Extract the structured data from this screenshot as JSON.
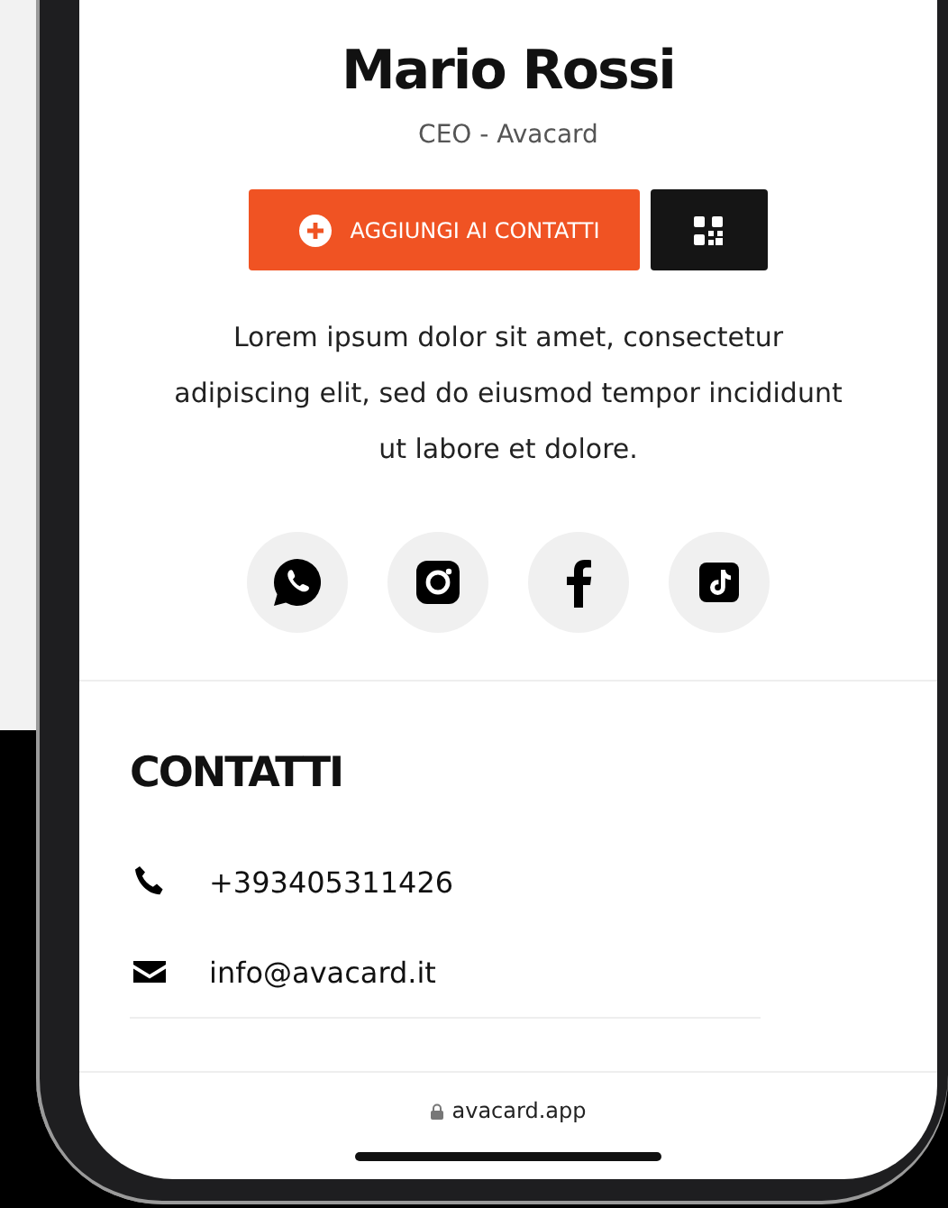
{
  "profile": {
    "name": "Mario Rossi",
    "role": "CEO - Avacard",
    "bio": "Lorem ipsum dolor sit amet, consectetur adipiscing elit, sed do eiusmod tempor incididunt ut labore et dolore."
  },
  "actions": [
    {
      "kind": "add-contact",
      "label": "AGGIUNGI AI CONTATTI"
    },
    {
      "kind": "qr"
    }
  ],
  "social": [
    {
      "kind": "whatsapp"
    },
    {
      "kind": "instagram"
    },
    {
      "kind": "facebook"
    },
    {
      "kind": "tiktok"
    }
  ],
  "contacts": {
    "title": "CONTATTI",
    "items": [
      {
        "kind": "phone",
        "text": "+393405311426"
      },
      {
        "kind": "email",
        "text": "info@avacard.it"
      }
    ]
  },
  "browser": {
    "url": "avacard.app"
  }
}
